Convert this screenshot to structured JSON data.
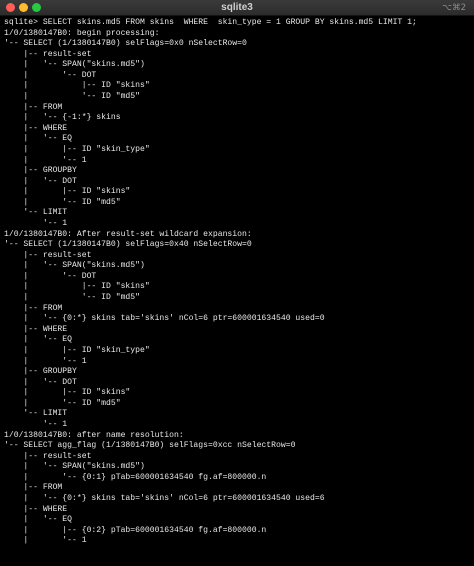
{
  "window": {
    "title": "sqlite3",
    "shortcut": "⌥⌘2"
  },
  "terminal": {
    "lines": [
      "sqlite> SELECT skins.md5 FROM skins  WHERE  skin_type = 1 GROUP BY skins.md5 LIMIT 1;",
      "1/0/1380147B0: begin processing:",
      "'-- SELECT (1/1380147B0) selFlags=0x0 nSelectRow=0",
      "    |-- result-set",
      "    |   '-- SPAN(\"skins.md5\")",
      "    |       '-- DOT",
      "    |           |-- ID \"skins\"",
      "    |           '-- ID \"md5\"",
      "    |-- FROM",
      "    |   '-- {-1:*} skins",
      "    |-- WHERE",
      "    |   '-- EQ",
      "    |       |-- ID \"skin_type\"",
      "    |       '-- 1",
      "    |-- GROUPBY",
      "    |   '-- DOT",
      "    |       |-- ID \"skins\"",
      "    |       '-- ID \"md5\"",
      "    '-- LIMIT",
      "        '-- 1",
      "1/0/1380147B0: After result-set wildcard expansion:",
      "'-- SELECT (1/1380147B0) selFlags=0x40 nSelectRow=0",
      "    |-- result-set",
      "    |   '-- SPAN(\"skins.md5\")",
      "    |       '-- DOT",
      "    |           |-- ID \"skins\"",
      "    |           '-- ID \"md5\"",
      "    |-- FROM",
      "    |   '-- {0:*} skins tab='skins' nCol=6 ptr=600001634540 used=0",
      "    |-- WHERE",
      "    |   '-- EQ",
      "    |       |-- ID \"skin_type\"",
      "    |       '-- 1",
      "    |-- GROUPBY",
      "    |   '-- DOT",
      "    |       |-- ID \"skins\"",
      "    |       '-- ID \"md5\"",
      "    '-- LIMIT",
      "        '-- 1",
      "1/0/1380147B0: after name resolution:",
      "'-- SELECT agg_flag (1/1380147B0) selFlags=0xcc nSelectRow=0",
      "    |-- result-set",
      "    |   '-- SPAN(\"skins.md5\")",
      "    |       '-- {0:1} pTab=600001634540 fg.af=800000.n",
      "    |-- FROM",
      "    |   '-- {0:*} skins tab='skins' nCol=6 ptr=600001634540 used=6",
      "    |-- WHERE",
      "    |   '-- EQ",
      "    |       |-- {0:2} pTab=600001634540 fg.af=800000.n",
      "    |       '-- 1"
    ]
  },
  "colors": {
    "background": "#000000",
    "text": "#e8e8e8",
    "titlebar": "#333333",
    "close": "#ff5f57",
    "minimize": "#febc2e",
    "maximize": "#28c840"
  }
}
